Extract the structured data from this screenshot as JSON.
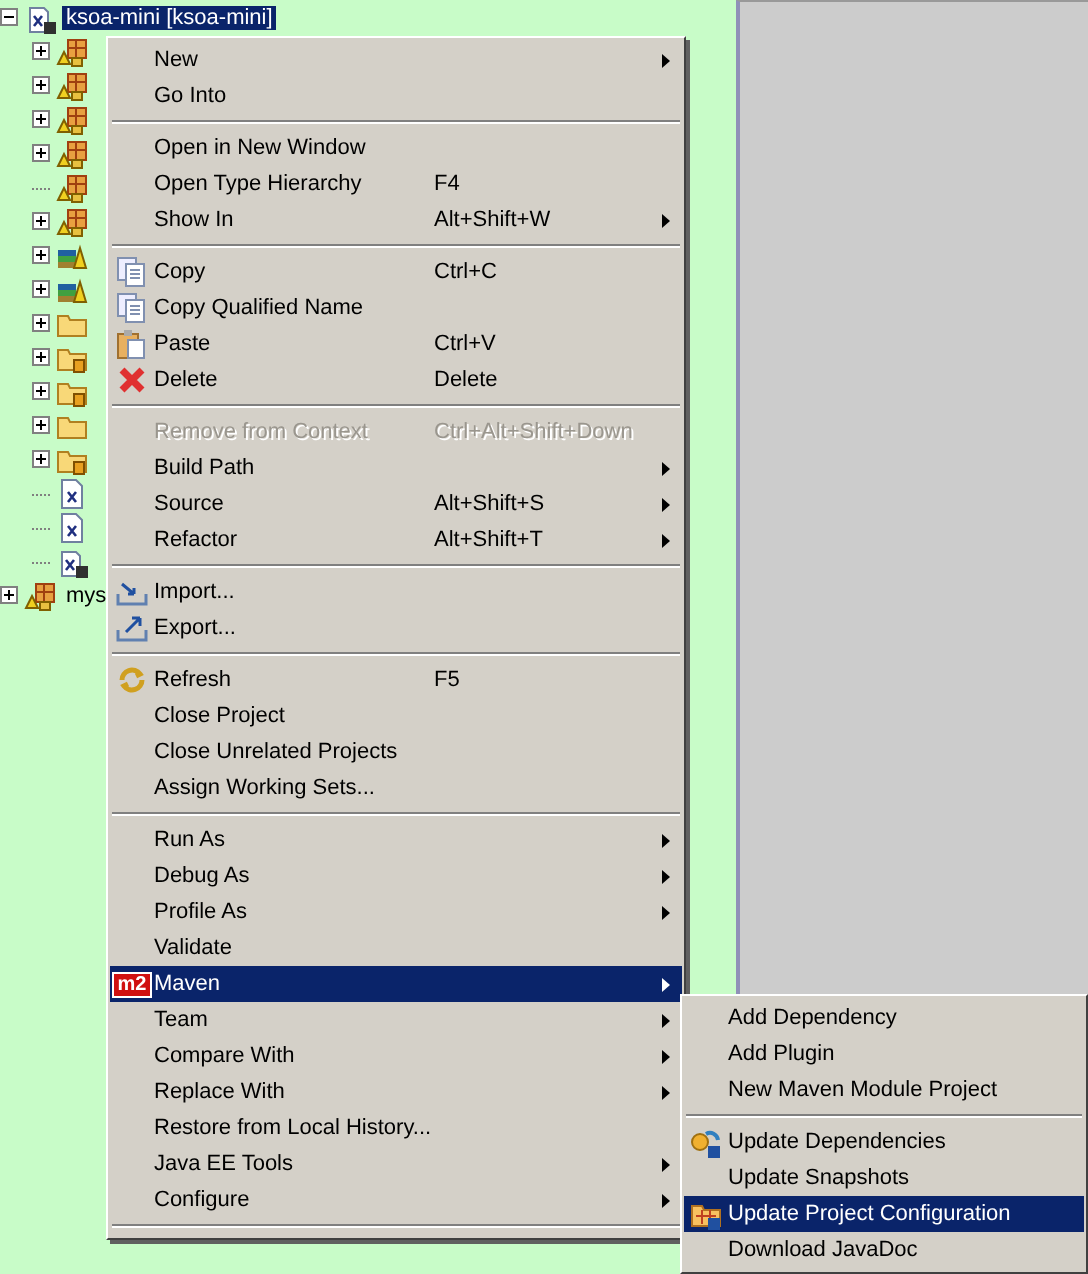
{
  "tree": {
    "root": {
      "label": "ksoa-mini [ksoa-mini]",
      "selected": true,
      "expanded": true
    },
    "children": [
      {
        "kind": "package",
        "expandable": true
      },
      {
        "kind": "package",
        "expandable": true
      },
      {
        "kind": "package",
        "expandable": true
      },
      {
        "kind": "package",
        "expandable": true
      },
      {
        "kind": "package",
        "expandable": false
      },
      {
        "kind": "package",
        "expandable": true
      },
      {
        "kind": "library",
        "expandable": true
      },
      {
        "kind": "library",
        "expandable": true
      },
      {
        "kind": "folder",
        "expandable": true
      },
      {
        "kind": "jarfolder",
        "expandable": true
      },
      {
        "kind": "jarfolder",
        "expandable": true
      },
      {
        "kind": "folder",
        "expandable": true
      },
      {
        "kind": "jarfolder",
        "expandable": true
      },
      {
        "kind": "xml",
        "expandable": false
      },
      {
        "kind": "xml",
        "expandable": false
      },
      {
        "kind": "pom",
        "expandable": false
      }
    ],
    "sibling": {
      "label": "mys",
      "expanded": false
    }
  },
  "context_menu": [
    {
      "kind": "plain",
      "label": "New",
      "submenu": true
    },
    {
      "kind": "plain",
      "label": "Go Into"
    },
    {
      "kind": "separator"
    },
    {
      "kind": "plain",
      "label": "Open in New Window"
    },
    {
      "kind": "plain",
      "label": "Open Type Hierarchy",
      "shortcut": "F4"
    },
    {
      "kind": "plain",
      "label": "Show In",
      "shortcut": "Alt+Shift+W",
      "submenu": true
    },
    {
      "kind": "separator"
    },
    {
      "kind": "copy",
      "label": "Copy",
      "shortcut": "Ctrl+C"
    },
    {
      "kind": "copy",
      "label": "Copy Qualified Name"
    },
    {
      "kind": "paste",
      "label": "Paste",
      "shortcut": "Ctrl+V"
    },
    {
      "kind": "delete",
      "label": "Delete",
      "shortcut": "Delete"
    },
    {
      "kind": "separator"
    },
    {
      "kind": "plain",
      "label": "Remove from Context",
      "shortcut": "Ctrl+Alt+Shift+Down",
      "disabled": true
    },
    {
      "kind": "plain",
      "label": "Build Path",
      "submenu": true
    },
    {
      "kind": "plain",
      "label": "Source",
      "shortcut": "Alt+Shift+S",
      "submenu": true
    },
    {
      "kind": "plain",
      "label": "Refactor",
      "shortcut": "Alt+Shift+T",
      "submenu": true
    },
    {
      "kind": "separator"
    },
    {
      "kind": "import",
      "label": "Import..."
    },
    {
      "kind": "export",
      "label": "Export..."
    },
    {
      "kind": "separator"
    },
    {
      "kind": "refresh",
      "label": "Refresh",
      "shortcut": "F5"
    },
    {
      "kind": "plain",
      "label": "Close Project"
    },
    {
      "kind": "plain",
      "label": "Close Unrelated Projects"
    },
    {
      "kind": "plain",
      "label": "Assign Working Sets..."
    },
    {
      "kind": "separator"
    },
    {
      "kind": "plain",
      "label": "Run As",
      "submenu": true
    },
    {
      "kind": "plain",
      "label": "Debug As",
      "submenu": true
    },
    {
      "kind": "plain",
      "label": "Profile As",
      "submenu": true
    },
    {
      "kind": "plain",
      "label": "Validate"
    },
    {
      "kind": "badge",
      "label": "Maven",
      "submenu": true,
      "selected": true,
      "badge": "m2"
    },
    {
      "kind": "plain",
      "label": "Team",
      "submenu": true
    },
    {
      "kind": "plain",
      "label": "Compare With",
      "submenu": true
    },
    {
      "kind": "plain",
      "label": "Replace With",
      "submenu": true
    },
    {
      "kind": "plain",
      "label": "Restore from Local History..."
    },
    {
      "kind": "plain",
      "label": "Java EE Tools",
      "submenu": true
    },
    {
      "kind": "plain",
      "label": "Configure",
      "submenu": true
    },
    {
      "kind": "separator"
    }
  ],
  "maven_submenu": [
    {
      "kind": "plain",
      "label": "Add Dependency"
    },
    {
      "kind": "plain",
      "label": "Add Plugin"
    },
    {
      "kind": "plain",
      "label": "New Maven Module Project"
    },
    {
      "kind": "separator"
    },
    {
      "kind": "update",
      "label": "Update Dependencies"
    },
    {
      "kind": "plain",
      "label": "Update Snapshots"
    },
    {
      "kind": "config",
      "label": "Update Project Configuration",
      "selected": true
    },
    {
      "kind": "plain",
      "label": "Download JavaDoc"
    }
  ]
}
